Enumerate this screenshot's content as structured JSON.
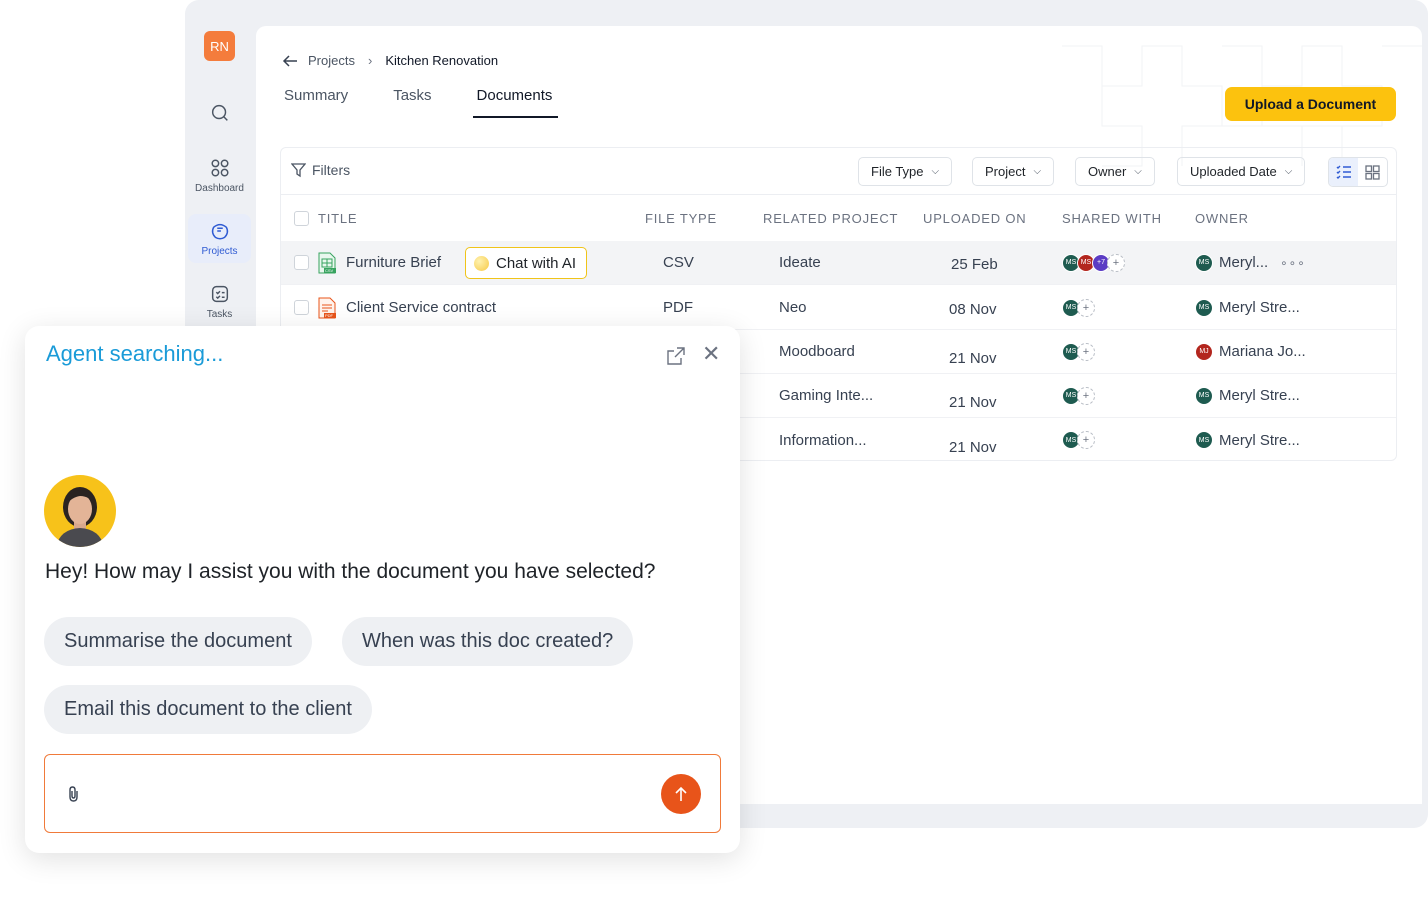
{
  "sidebar": {
    "user_initials": "RN",
    "items": [
      {
        "icon": "search-icon",
        "label": ""
      },
      {
        "icon": "dashboard-icon",
        "label": "Dashboard"
      },
      {
        "icon": "projects-icon",
        "label": "Projects"
      },
      {
        "icon": "tasks-icon",
        "label": "Tasks"
      }
    ]
  },
  "breadcrumb": {
    "parent": "Projects",
    "current": "Kitchen Renovation"
  },
  "tabs": [
    {
      "label": "Summary"
    },
    {
      "label": "Tasks"
    },
    {
      "label": "Documents"
    }
  ],
  "active_tab": "Documents",
  "upload_label": "Upload a Document",
  "filters": {
    "label": "Filters",
    "dropdowns": [
      "File Type",
      "Project",
      "Owner",
      "Uploaded Date"
    ]
  },
  "table": {
    "headers": [
      "TITLE",
      "FILE TYPE",
      "RELATED PROJECT",
      "UPLOADED ON",
      "SHARED WITH",
      "OWNER"
    ],
    "rows": [
      {
        "title": "Furniture Brief",
        "file_type": "CSV",
        "project": "Ideate",
        "uploaded": "25 Feb",
        "shared": [
          "MS",
          "MS",
          "+7"
        ],
        "owner_initials": "MS",
        "owner": "Meryl..."
      },
      {
        "title": "Client Service contract",
        "file_type": "PDF",
        "project": "Neo",
        "uploaded": "08 Nov",
        "shared": [
          "MS"
        ],
        "owner_initials": "MS",
        "owner": "Meryl Stre..."
      },
      {
        "title": "",
        "file_type": "",
        "project": "Moodboard",
        "uploaded": "21 Nov",
        "shared": [
          "MS"
        ],
        "owner_initials": "MJ",
        "owner": "Mariana Jo..."
      },
      {
        "title": "",
        "file_type": "",
        "project": "Gaming Inte...",
        "uploaded": "21 Nov",
        "shared": [
          "MS"
        ],
        "owner_initials": "MS",
        "owner": "Meryl Stre..."
      },
      {
        "title": "",
        "file_type": "",
        "project": "Information...",
        "uploaded": "21 Nov",
        "shared": [
          "MS"
        ],
        "owner_initials": "MS",
        "owner": "Meryl Stre..."
      }
    ]
  },
  "chat_with_ai_label": "Chat with AI",
  "file_icon_labels": {
    "csv": "CSV",
    "pdf": "PDF"
  },
  "chat": {
    "title": "Agent searching...",
    "greeting": "Hey! How may I assist you with the document you have selected?",
    "suggestions": [
      "Summarise the document",
      "When was this doc created?",
      "Email this document to the client"
    ],
    "input_placeholder": ""
  },
  "colors": {
    "accent_yellow": "#fcc20e",
    "chat_title": "#1a9bd8",
    "send_button": "#e8541a",
    "input_border": "#f07a3a"
  }
}
